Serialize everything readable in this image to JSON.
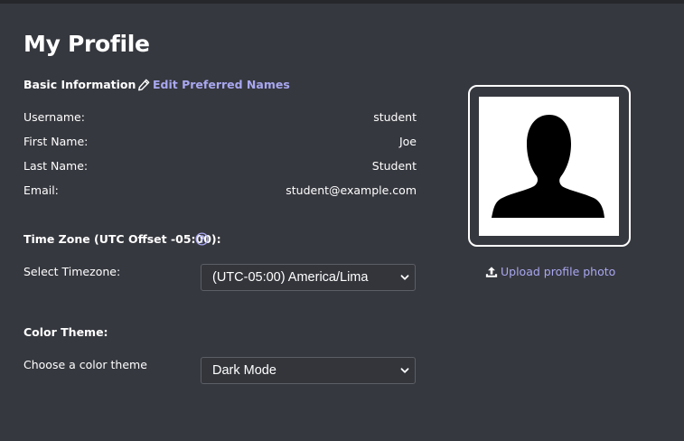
{
  "page": {
    "title": "My Profile"
  },
  "basic_info": {
    "heading": "Basic Information",
    "edit_link": "Edit Preferred Names",
    "fields": [
      {
        "label": "Username:",
        "value": "student"
      },
      {
        "label": "First Name:",
        "value": "Joe"
      },
      {
        "label": "Last Name:",
        "value": "Student"
      },
      {
        "label": "Email:",
        "value": "student@example.com"
      }
    ]
  },
  "timezone": {
    "heading": "Time Zone (UTC Offset -05:00):",
    "select_label": "Select Timezone:",
    "selected": "(UTC-05:00) America/Lima"
  },
  "theme": {
    "heading": "Color Theme:",
    "select_label": "Choose a color theme",
    "selected": "Dark Mode"
  },
  "photo": {
    "upload_label": "Upload profile photo"
  },
  "colors": {
    "background": "#36383f",
    "link": "#a9a7f0",
    "text": "#ffffff"
  },
  "icons": {
    "edit": "pencil-icon",
    "help": "question-circle-icon",
    "dropdown": "chevron-down-icon",
    "upload": "upload-icon",
    "avatar": "person-silhouette-icon"
  }
}
